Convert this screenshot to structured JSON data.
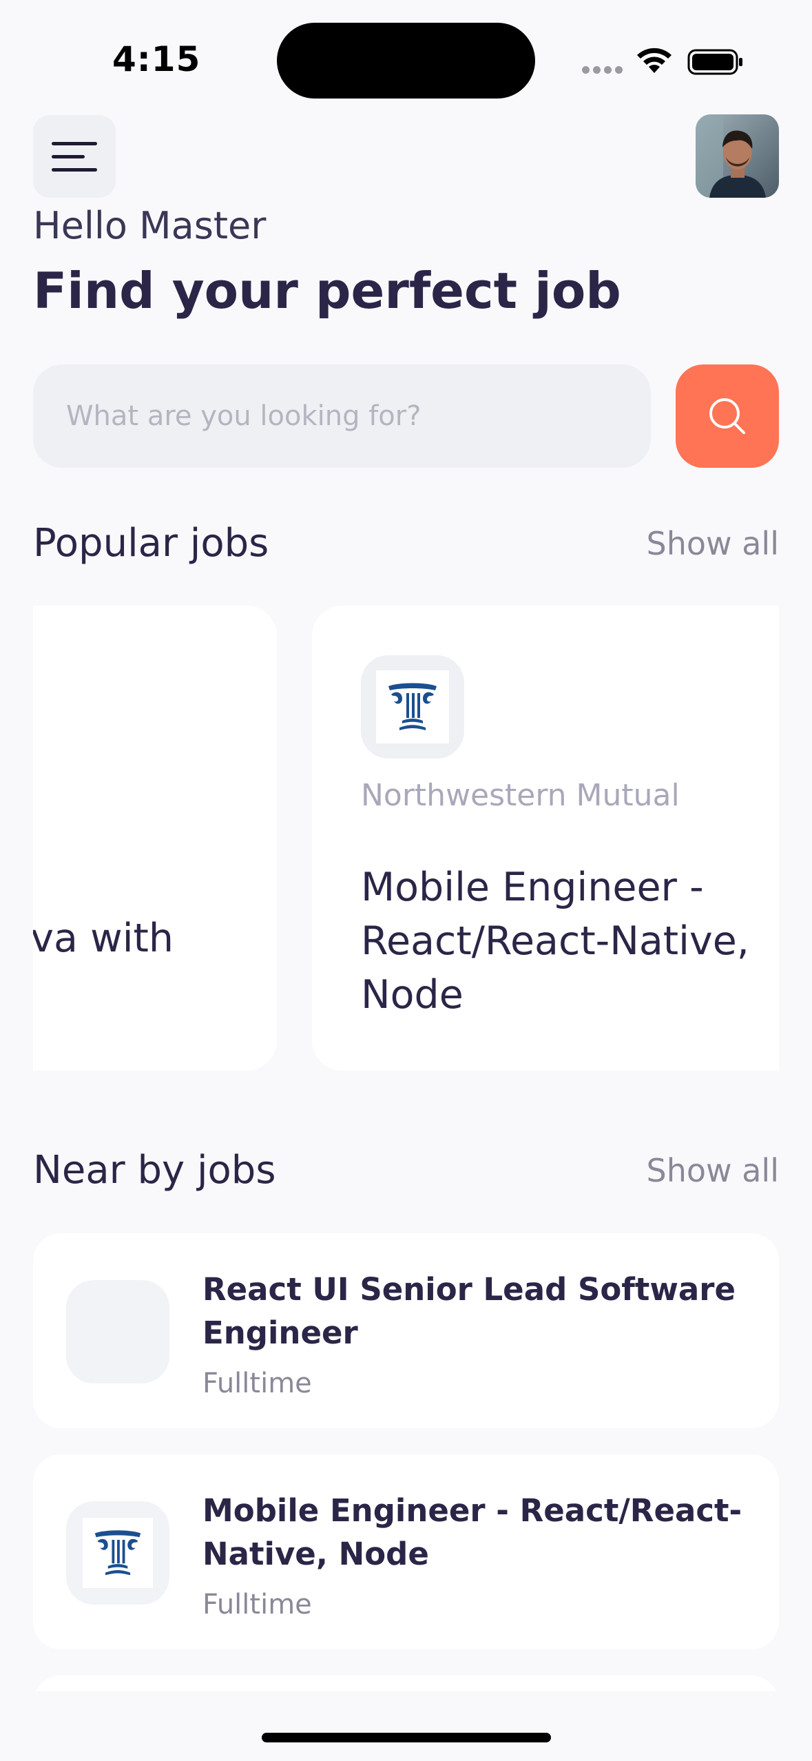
{
  "status": {
    "time": "4:15"
  },
  "header": {
    "greeting": "Hello Master",
    "headline": "Find your perfect job"
  },
  "search": {
    "placeholder": "What are you looking for?",
    "value": ""
  },
  "popular": {
    "title": "Popular jobs",
    "show_all": "Show all",
    "cards": [
      {
        "title_fragment": "ava with"
      },
      {
        "company": "Northwestern Mutual",
        "title": "Mobile Engineer - React/React-Native, Node"
      }
    ]
  },
  "nearby": {
    "title": "Near by jobs",
    "show_all": "Show all",
    "jobs": [
      {
        "title": "React UI Senior Lead Software Engineer",
        "type": "Fulltime"
      },
      {
        "title": "Mobile Engineer - React/React-Native, Node",
        "type": "Fulltime"
      }
    ]
  },
  "colors": {
    "accent": "#FF7454",
    "text": "#2B2647",
    "background": "#F9F9FC",
    "card": "#FFFFFF"
  },
  "icons": [
    "menu-icon",
    "search-icon",
    "wifi-icon",
    "battery-icon",
    "company-logo"
  ]
}
